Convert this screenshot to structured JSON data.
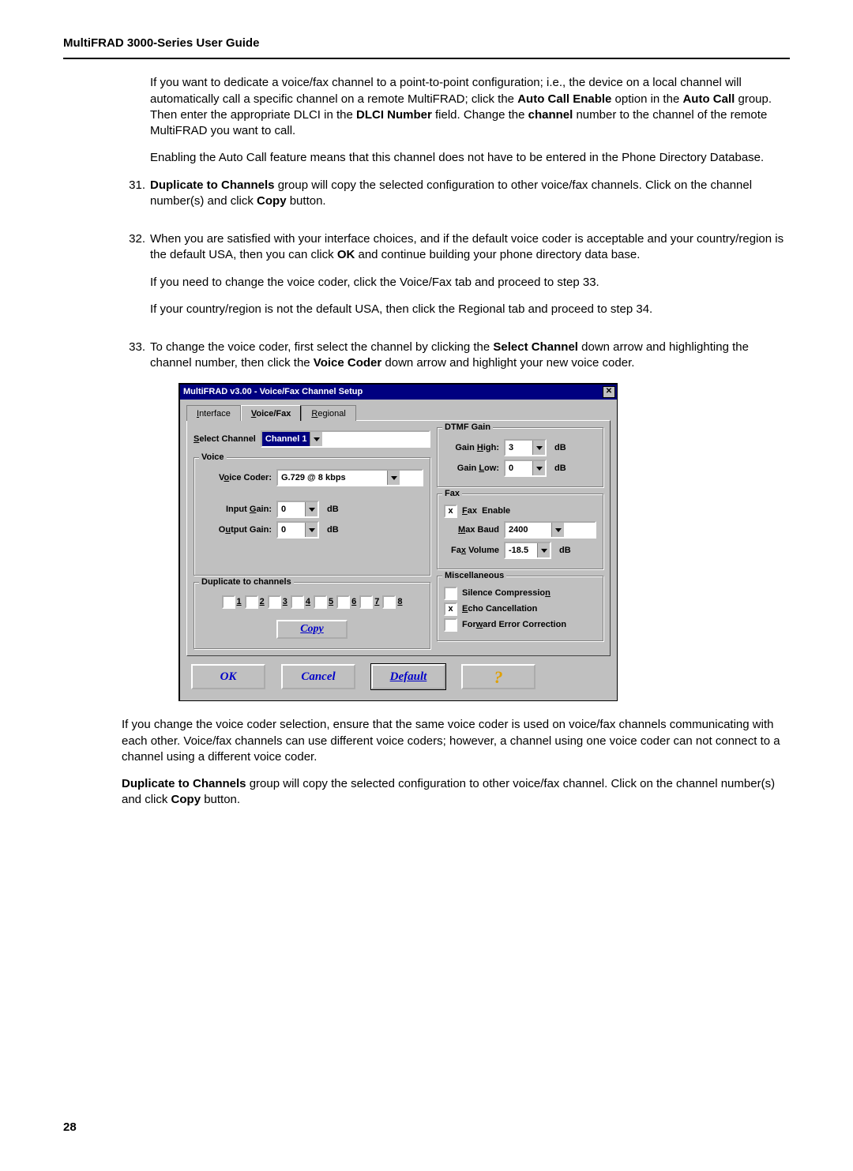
{
  "header_title": "MultiFRAD 3000-Series User Guide",
  "page_number": "28",
  "para_intro_1": "If you want to dedicate a voice/fax channel to a point-to-point configuration; i.e., the device on a local channel will automatically call a specific channel on a remote MultiFRAD; click the ",
  "bold_auto_call_enable": "Auto Call Enable",
  "para_intro_2": " option in the ",
  "bold_auto_call": "Auto Call",
  "para_intro_3": " group.  Then enter the appropriate DLCI in the ",
  "bold_dlci_number": "DLCI Number",
  "para_intro_4": " field.  Change the ",
  "bold_channel": "channel",
  "para_intro_5": " number to the channel of the remote MultiFRAD you want to call.",
  "para_enabling": "Enabling the Auto Call feature means that this channel does not have to be entered in the Phone Directory Database.",
  "item31_num": "31.",
  "item31_bold": "Duplicate to Channels",
  "item31_text": " group will copy the selected configuration to other voice/fax channels.  Click on the channel number(s) and click ",
  "item31_copy": "Copy",
  "item31_end": " button.",
  "item32_num": "32.",
  "item32_p1a": "When you are satisfied with your interface choices, and if the default voice coder is acceptable and your country/region is the default USA, then you can click ",
  "item32_ok": "OK",
  "item32_p1b": " and continue building your phone directory data base.",
  "item32_p2": "If you need to change the voice coder, click the Voice/Fax tab and proceed to step 33.",
  "item32_p3": "If your country/region is not the default USA, then click the Regional tab and proceed to step 34.",
  "item33_num": "33.",
  "item33_a": "To change the voice coder, first select the channel by clicking the ",
  "item33_select_channel": "Select Channel",
  "item33_b": " down arrow and highlighting the channel number, then click the ",
  "item33_voice_coder": "Voice Coder",
  "item33_c": " down arrow and highlight your new voice coder.",
  "after_para1": "If you change the voice coder selection, ensure that the same voice coder is used on voice/fax channels communicating with each other.   Voice/fax channels can use different voice coders; however, a channel using one voice coder can not connect to a channel using a different voice coder.",
  "after_bold_dup": "Duplicate to Channels",
  "after_para2a": " group will copy the selected configuration to other voice/fax channel. Click on the channel number(s) and click ",
  "after_copy": "Copy",
  "after_para2b": " button.",
  "dialog": {
    "title": "MultiFRAD v3.00 - Voice/Fax Channel Setup",
    "tabs": {
      "interface": "Interface",
      "voicefax": "Voice/Fax",
      "regional": "Regional"
    },
    "select_channel_label": "Select Channel",
    "select_channel_value": "Channel 1",
    "voice_group": "Voice",
    "voice_coder_label": "Voice Coder:",
    "voice_coder_value": "G.729 @ 8 kbps",
    "input_gain_label": "Input Gain:",
    "input_gain_value": "0",
    "output_gain_label": "Output Gain:",
    "output_gain_value": "0",
    "db": "dB",
    "dtmf_group": "DTMF Gain",
    "gain_high_label": "Gain High:",
    "gain_high_value": "3",
    "gain_low_label": "Gain Low:",
    "gain_low_value": "0",
    "fax_group": "Fax",
    "fax_enable": "Fax  Enable",
    "max_baud_label": "Max Baud",
    "max_baud_value": "2400",
    "fax_volume_label": "Fax Volume",
    "fax_volume_value": "-18.5",
    "dup_group": "Duplicate to channels",
    "channels": [
      "1",
      "2",
      "3",
      "4",
      "5",
      "6",
      "7",
      "8"
    ],
    "copy_btn": "Copy",
    "misc_group": "Miscellaneous",
    "silence": "Silence Compression",
    "echo": "Echo Cancellation",
    "fec": "Forward Error Correction",
    "ok": "OK",
    "cancel": "Cancel",
    "default": "Default",
    "help": "?"
  }
}
